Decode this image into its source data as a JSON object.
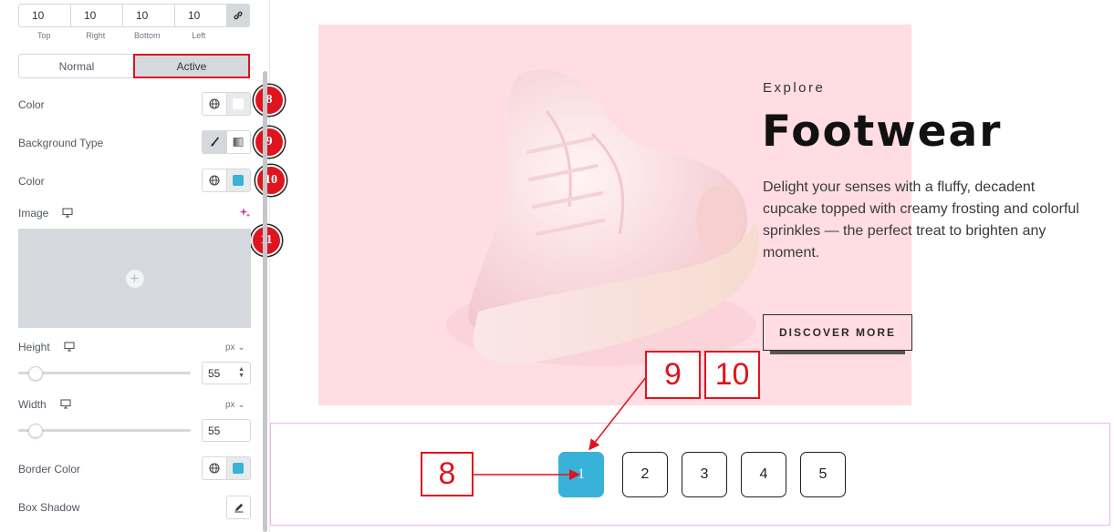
{
  "panel": {
    "dimensions": {
      "values": [
        "10",
        "10",
        "10",
        "10"
      ],
      "labels": [
        "Top",
        "Right",
        "Bottom",
        "Left"
      ]
    },
    "tabs": [
      {
        "label": "Normal",
        "active": false
      },
      {
        "label": "Active",
        "active": true
      }
    ],
    "color_label": "Color",
    "background_type_label": "Background Type",
    "color2_label": "Color",
    "image_label": "Image",
    "height": {
      "label": "Height",
      "unit": "px",
      "value": "55",
      "slider_fraction": 0.1
    },
    "width": {
      "label": "Width",
      "unit": "px",
      "value": "55",
      "slider_fraction": 0.1
    },
    "border_color_label": "Border Color",
    "box_shadow_label": "Box Shadow",
    "colors": {
      "swatch_white": "#ffffff",
      "swatch_blue": "#38b2d8"
    }
  },
  "badges": [
    "8",
    "9",
    "10",
    "11"
  ],
  "preview": {
    "eyebrow": "Explore",
    "title": "Footwear",
    "description": "Delight your senses with a fluffy, decadent cupcake topped with creamy frosting and colorful sprinkles — the perfect treat to brighten any moment.",
    "cta_label": "DISCOVER MORE",
    "hero_bg": "#ffdde2"
  },
  "pagination": {
    "pages": [
      "1",
      "2",
      "3",
      "4",
      "5"
    ],
    "active_page": "1",
    "active_color": "#38b2d8"
  },
  "annotations": {
    "box_8": "8",
    "box_9": "9",
    "box_10": "10"
  }
}
